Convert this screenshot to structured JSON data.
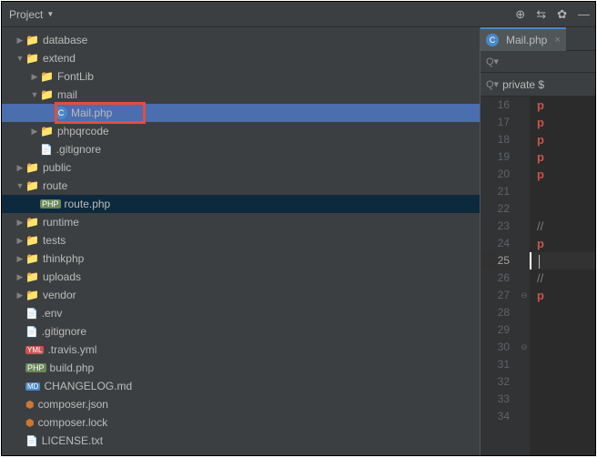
{
  "toolbar": {
    "project_label": "Project"
  },
  "tree": [
    {
      "indent": 0,
      "arrow": "closed",
      "icon": "folder",
      "label": "database"
    },
    {
      "indent": 0,
      "arrow": "open",
      "icon": "folder",
      "label": "extend"
    },
    {
      "indent": 1,
      "arrow": "closed",
      "icon": "folder",
      "label": "FontLib"
    },
    {
      "indent": 1,
      "arrow": "open",
      "icon": "folder",
      "label": "mail"
    },
    {
      "indent": 2,
      "arrow": "none",
      "icon": "class",
      "label": "Mail.php",
      "selected": "hover",
      "highlighted": true
    },
    {
      "indent": 1,
      "arrow": "closed",
      "icon": "folder",
      "label": "phpqrcode"
    },
    {
      "indent": 1,
      "arrow": "none",
      "icon": "txt",
      "label": ".gitignore"
    },
    {
      "indent": 0,
      "arrow": "closed",
      "icon": "folder",
      "label": "public"
    },
    {
      "indent": 0,
      "arrow": "open",
      "icon": "folder",
      "label": "route"
    },
    {
      "indent": 1,
      "arrow": "none",
      "icon": "php",
      "label": "route.php",
      "selected": "selected"
    },
    {
      "indent": 0,
      "arrow": "closed",
      "icon": "folder",
      "label": "runtime"
    },
    {
      "indent": 0,
      "arrow": "closed",
      "icon": "folder",
      "label": "tests"
    },
    {
      "indent": 0,
      "arrow": "closed",
      "icon": "folder",
      "label": "thinkphp"
    },
    {
      "indent": 0,
      "arrow": "closed",
      "icon": "folder",
      "label": "uploads"
    },
    {
      "indent": 0,
      "arrow": "closed",
      "icon": "folder",
      "label": "vendor"
    },
    {
      "indent": 0,
      "arrow": "none",
      "icon": "txt",
      "label": ".env"
    },
    {
      "indent": 0,
      "arrow": "none",
      "icon": "txt",
      "label": ".gitignore"
    },
    {
      "indent": 0,
      "arrow": "none",
      "icon": "yml",
      "label": ".travis.yml"
    },
    {
      "indent": 0,
      "arrow": "none",
      "icon": "php",
      "label": "build.php"
    },
    {
      "indent": 0,
      "arrow": "none",
      "icon": "md",
      "label": "CHANGELOG.md"
    },
    {
      "indent": 0,
      "arrow": "none",
      "icon": "json",
      "label": "composer.json"
    },
    {
      "indent": 0,
      "arrow": "none",
      "icon": "json",
      "label": "composer.lock"
    },
    {
      "indent": 0,
      "arrow": "none",
      "icon": "txt",
      "label": "LICENSE.txt"
    }
  ],
  "editor": {
    "tab_label": "Mail.php",
    "search_term": "private $",
    "lines": [
      {
        "num": 16,
        "kind": "pub",
        "text": "p"
      },
      {
        "num": 17,
        "kind": "pub",
        "text": "p"
      },
      {
        "num": 18,
        "kind": "pub",
        "text": "p"
      },
      {
        "num": 19,
        "kind": "pub",
        "text": "p"
      },
      {
        "num": 20,
        "kind": "pub",
        "text": "p"
      },
      {
        "num": 21,
        "kind": "",
        "text": ""
      },
      {
        "num": 22,
        "kind": "",
        "text": ""
      },
      {
        "num": 23,
        "kind": "comment",
        "text": "//"
      },
      {
        "num": 24,
        "kind": "pub",
        "text": "p"
      },
      {
        "num": 25,
        "kind": "current",
        "text": ""
      },
      {
        "num": 26,
        "kind": "comment",
        "text": "//"
      },
      {
        "num": 27,
        "kind": "pub",
        "text": "p",
        "fold": "open"
      },
      {
        "num": 28,
        "kind": "",
        "text": ""
      },
      {
        "num": 29,
        "kind": "",
        "text": ""
      },
      {
        "num": 30,
        "kind": "",
        "text": "",
        "fold": "close"
      },
      {
        "num": 31,
        "kind": "",
        "text": ""
      },
      {
        "num": 32,
        "kind": "",
        "text": ""
      },
      {
        "num": 33,
        "kind": "",
        "text": ""
      },
      {
        "num": 34,
        "kind": "",
        "text": ""
      }
    ]
  }
}
